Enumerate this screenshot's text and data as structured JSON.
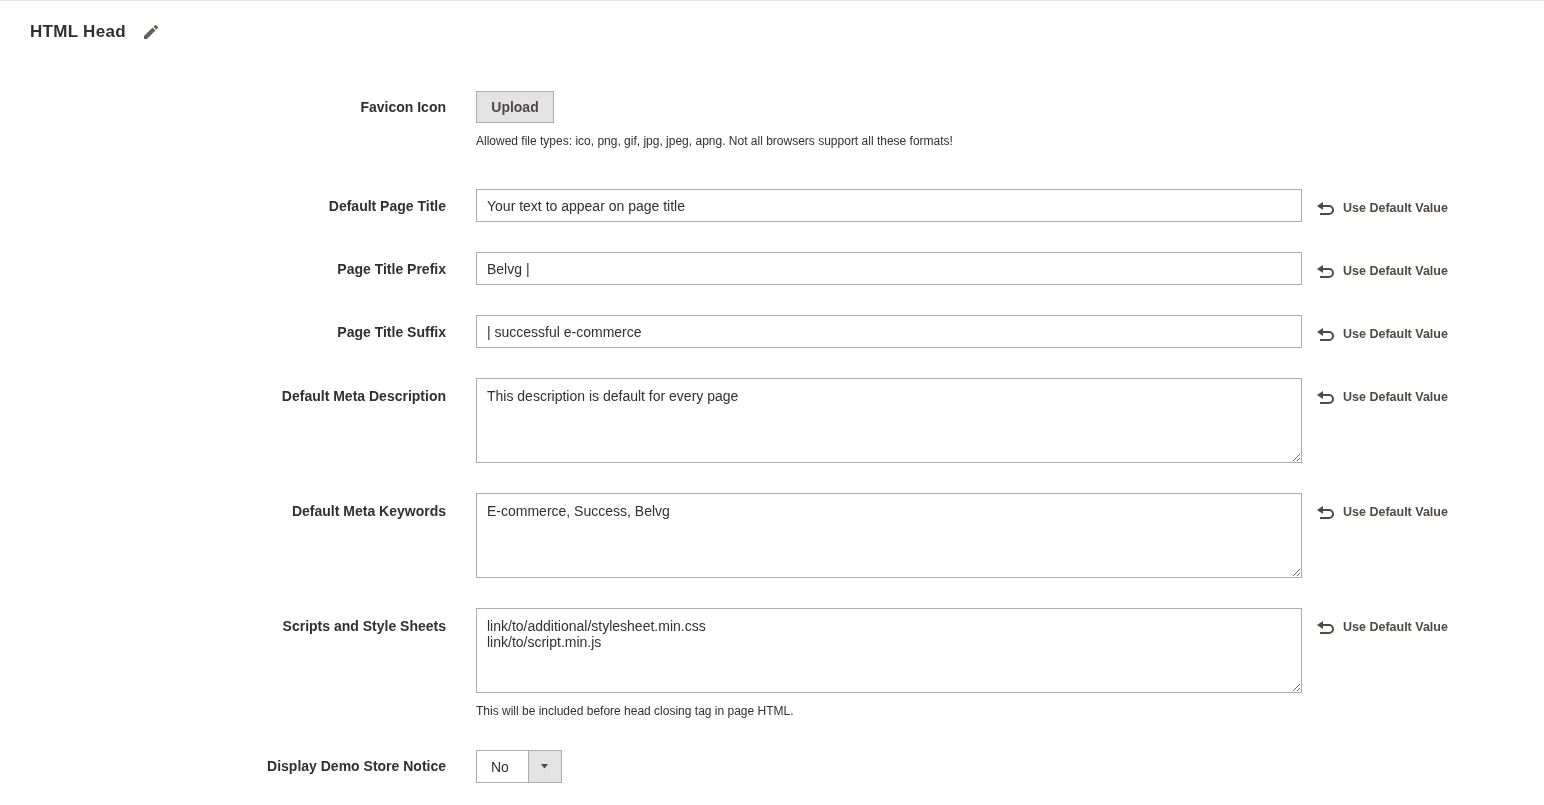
{
  "section": {
    "title": "HTML Head"
  },
  "fields": [
    {
      "kind": "upload",
      "label": "Favicon Icon",
      "button": "Upload",
      "note": "Allowed file types: ico, png, gif, jpg, jpeg, apng. Not all browsers support all these formats!"
    },
    {
      "kind": "text",
      "label": "Default Page Title",
      "value": "Your text to appear on page title",
      "use_default": "Use Default Value"
    },
    {
      "kind": "text",
      "label": "Page Title Prefix",
      "value": "Belvg |",
      "use_default": "Use Default Value"
    },
    {
      "kind": "text",
      "label": "Page Title Suffix",
      "value": "| successful e-commerce",
      "use_default": "Use Default Value"
    },
    {
      "kind": "textarea",
      "label": "Default Meta Description",
      "value": "This description is default for every page",
      "use_default": "Use Default Value"
    },
    {
      "kind": "textarea",
      "label": "Default Meta Keywords",
      "value": "E-commerce, Success, Belvg",
      "use_default": "Use Default Value"
    },
    {
      "kind": "textarea",
      "label": "Scripts and Style Sheets",
      "value": "link/to/additional/stylesheet.min.css\nlink/to/script.min.js",
      "use_default": "Use Default Value",
      "note": "This will be included before head closing tag in page HTML."
    },
    {
      "kind": "select",
      "label": "Display Demo Store Notice",
      "value": "No"
    }
  ]
}
